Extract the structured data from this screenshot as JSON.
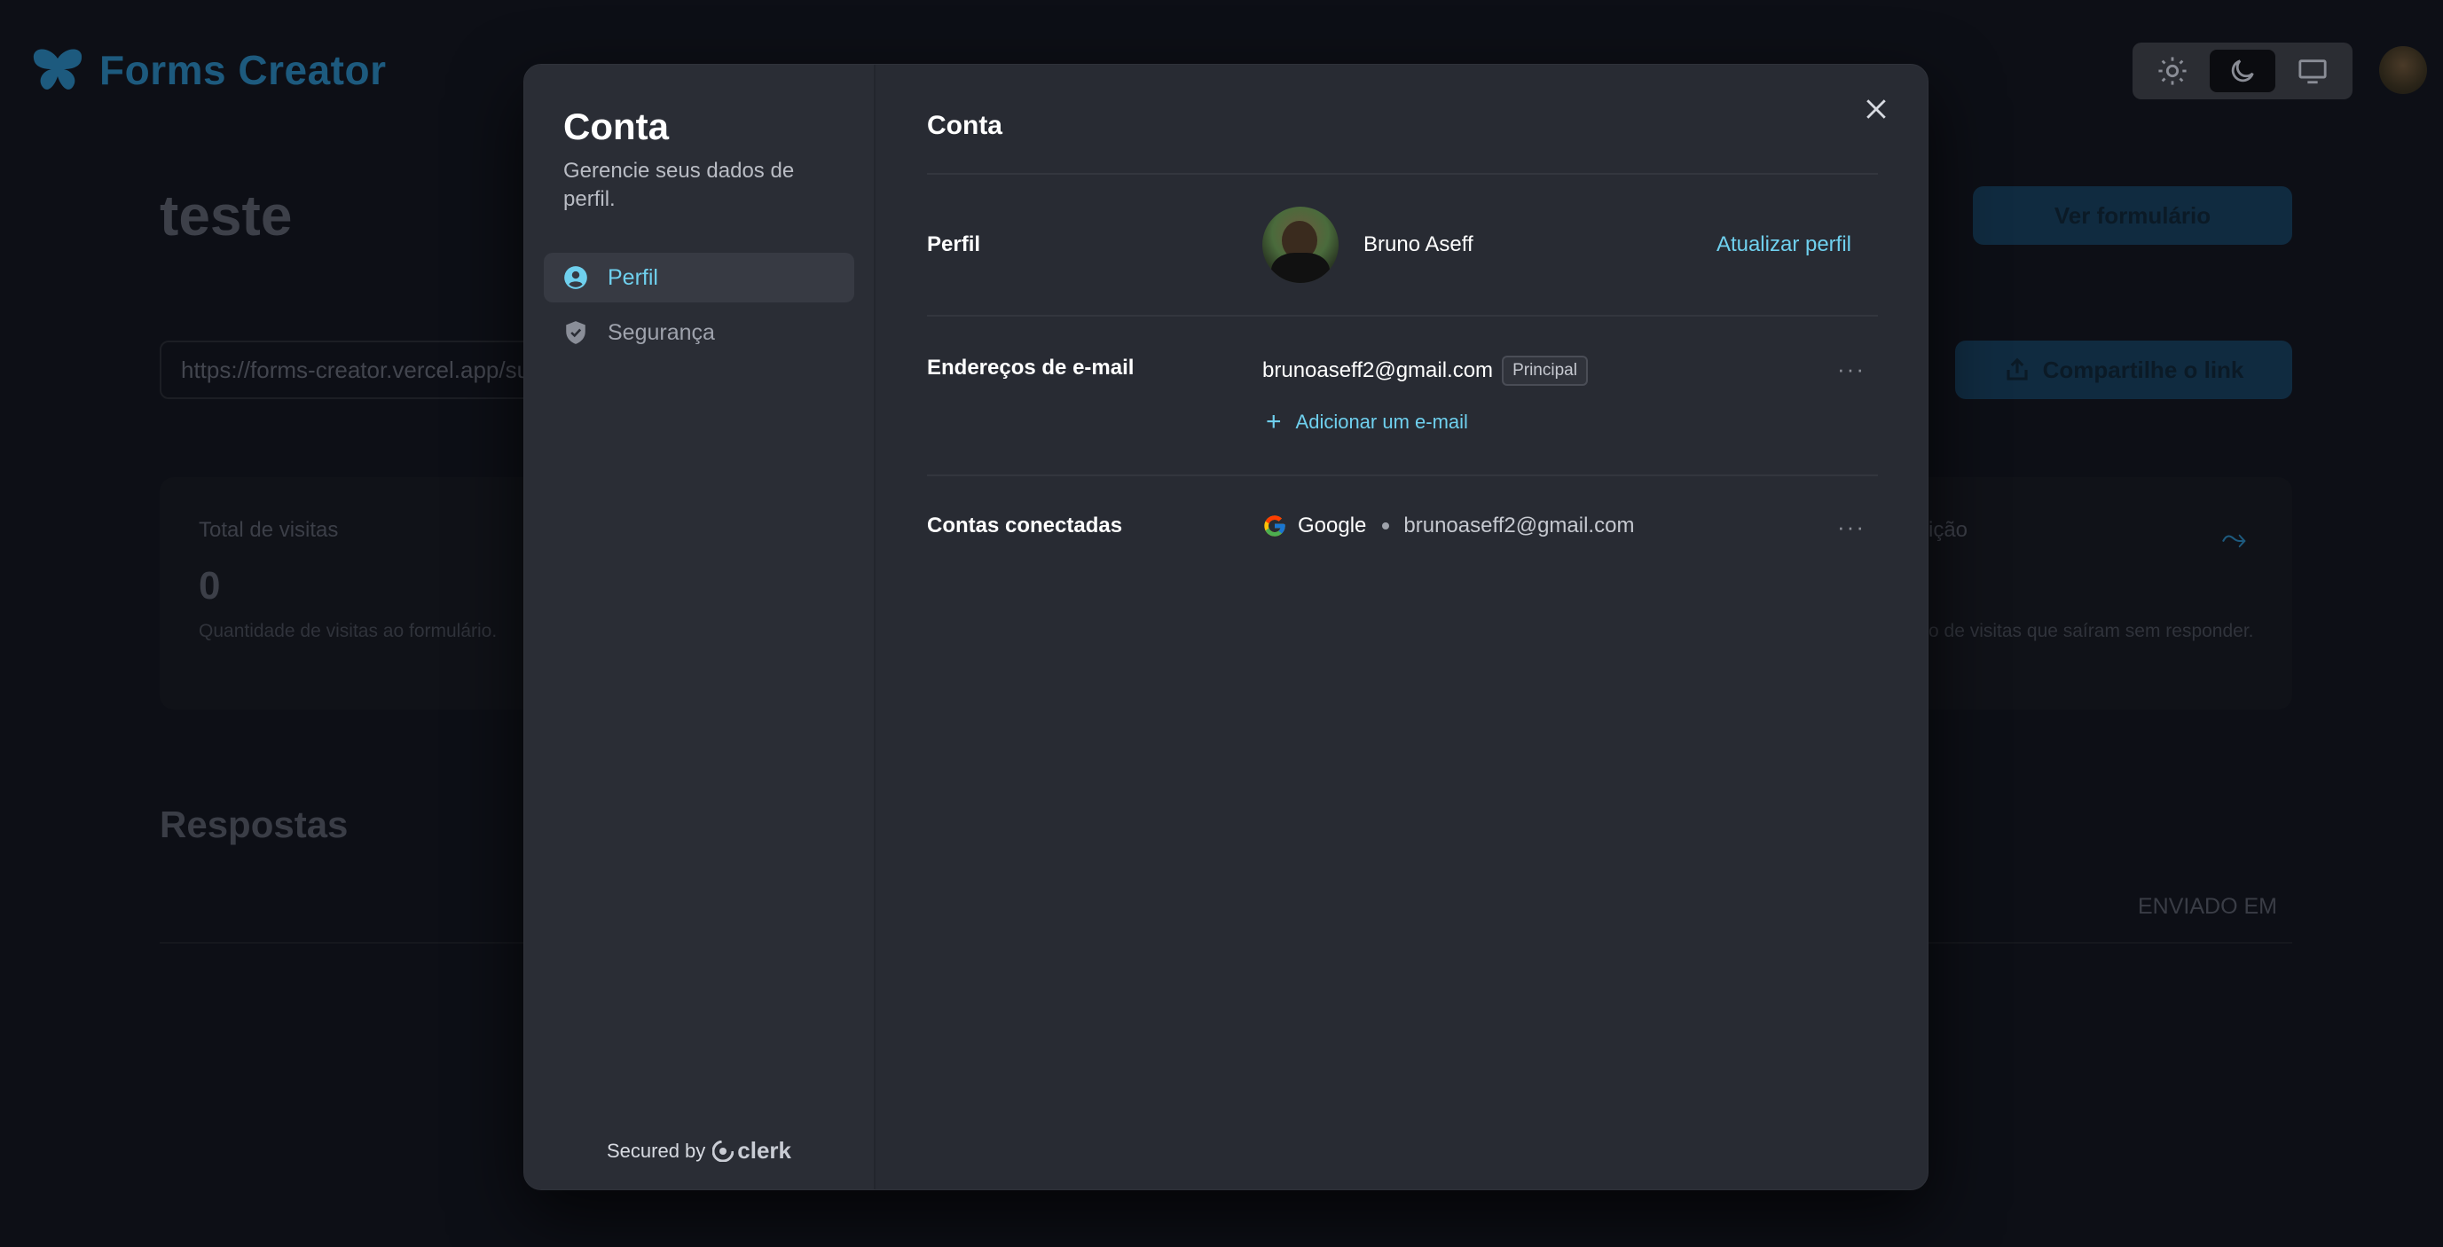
{
  "app": {
    "brand": "Forms Creator",
    "page_title": "teste",
    "view_form_label": "Ver formulário",
    "form_link": "https://forms-creator.vercel.app/su",
    "share_label": "Compartilhe o link",
    "stats": {
      "left_label": "Total de visitas",
      "left_value": "0",
      "left_desc": "Quantidade de visitas ao formulário.",
      "right_label": "ição",
      "right_desc": "o de visitas que saíram sem responder."
    },
    "responses_title": "Respostas",
    "sent_at_header": "ENVIADO EM"
  },
  "modal": {
    "side_title": "Conta",
    "side_subtitle": "Gerencie seus dados de perfil.",
    "nav": [
      {
        "label": "Perfil",
        "icon": "user-circle-icon",
        "active": true
      },
      {
        "label": "Segurança",
        "icon": "shield-check-icon",
        "active": false
      }
    ],
    "secured_by": "Secured by",
    "clerk_brand": "clerk",
    "main_title": "Conta",
    "profile": {
      "label": "Perfil",
      "name": "Bruno Aseff",
      "action": "Atualizar perfil"
    },
    "emails": {
      "label": "Endereços de e-mail",
      "primary_email": "brunoaseff2@gmail.com",
      "primary_badge": "Principal",
      "add_label": "Adicionar um e-mail"
    },
    "connected": {
      "label": "Contas conectadas",
      "provider": "Google",
      "email": "brunoaseff2@gmail.com"
    },
    "more_glyph": "···"
  },
  "colors": {
    "accent": "#6fd0ee",
    "modal_bg": "#282b33",
    "brand_dimmed": "#1d5a7e"
  }
}
